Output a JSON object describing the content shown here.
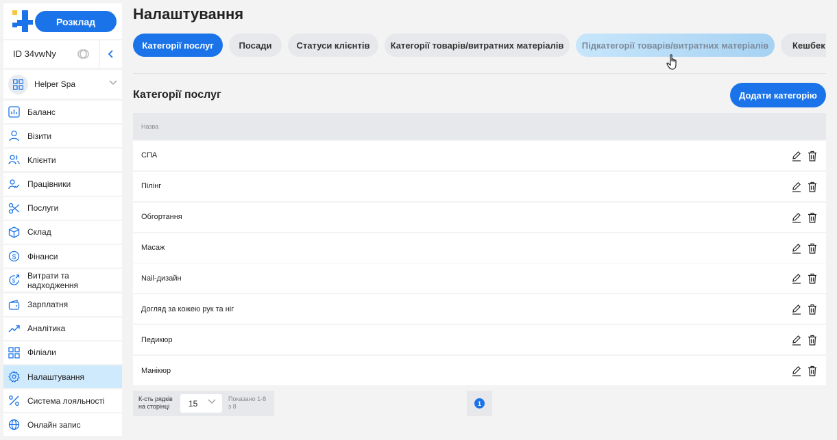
{
  "sidebar": {
    "schedule_button": "Розклад",
    "account_id": "ID 34vwNy",
    "branch_name": "Helper Spa",
    "menu": [
      {
        "label": "Баланс",
        "icon": "chart-bar-icon"
      },
      {
        "label": "Візити",
        "icon": "user-icon"
      },
      {
        "label": "Клієнти",
        "icon": "users-icon"
      },
      {
        "label": "Працівники",
        "icon": "user-check-icon"
      },
      {
        "label": "Послуги",
        "icon": "scissors-icon"
      },
      {
        "label": "Склад",
        "icon": "box-icon"
      },
      {
        "label": "Фінанси",
        "icon": "dollar-circle-icon"
      },
      {
        "label": "Витрати та надходження",
        "icon": "money-flow-icon"
      },
      {
        "label": "Зарплатня",
        "icon": "wallet-icon"
      },
      {
        "label": "Аналітика",
        "icon": "trend-icon"
      },
      {
        "label": "Філіали",
        "icon": "grid-icon"
      },
      {
        "label": "Налаштування",
        "icon": "gear-icon",
        "active": true
      },
      {
        "label": "Система лояльності",
        "icon": "percent-icon"
      },
      {
        "label": "Онлайн запис",
        "icon": "globe-icon"
      }
    ]
  },
  "main": {
    "title": "Налаштування",
    "tabs": [
      {
        "label": "Категорії послуг",
        "state": "active"
      },
      {
        "label": "Посади",
        "state": "default"
      },
      {
        "label": "Статуси клієнтів",
        "state": "default"
      },
      {
        "label": "Категорії товарів/витратних матеріалів",
        "state": "default"
      },
      {
        "label": "Підкатегорії товарів/витратних матеріалів",
        "state": "hover"
      },
      {
        "label": "Кешбек",
        "state": "default"
      }
    ],
    "section_title": "Категорії послуг",
    "add_button": "Додати категорію",
    "table": {
      "header": "Назва",
      "rows": [
        "СПА",
        "Пілінг",
        "Обгортання",
        "Масаж",
        "Nail-дизайн",
        "Догляд за кожею рук та ніг",
        "Педикюр",
        "Манікюр"
      ]
    },
    "pagination": {
      "rows_label_line1": "К-сть рядків",
      "rows_label_line2": "на сторінці",
      "rows_per_page": "15",
      "shown_line1": "Показано 1-8",
      "shown_line2": "з 8",
      "current_page": "1"
    }
  },
  "colors": {
    "accent": "#1a73e8",
    "active_menu": "#cfeafd",
    "tab_bg": "#e6e8eb"
  }
}
